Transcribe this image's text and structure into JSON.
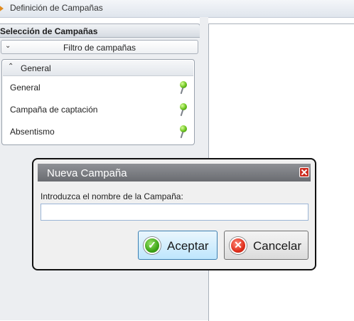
{
  "window": {
    "title": "Definición de Campañas",
    "icon": "app-arrow-icon"
  },
  "left_panel": {
    "header": "Selección de Campañas",
    "filter": {
      "label": "Filtro de campañas",
      "icon": "chevron-down-icon"
    },
    "group": {
      "label": "General",
      "icon": "chevron-up-icon"
    },
    "items": [
      {
        "label": "General",
        "icon": "green-pin-icon"
      },
      {
        "label": "Campaña de captación",
        "icon": "green-pin-icon"
      },
      {
        "label": "Absentismo",
        "icon": "green-pin-icon"
      }
    ]
  },
  "dialog": {
    "title": "Nueva Campaña",
    "prompt": "Introduzca el nombre de la Campaña:",
    "input_value": "",
    "accept_label": "Aceptar",
    "cancel_label": "Cancelar",
    "icons": {
      "close": "close-icon",
      "accept": "check-circle-icon",
      "cancel": "x-circle-icon"
    }
  }
}
